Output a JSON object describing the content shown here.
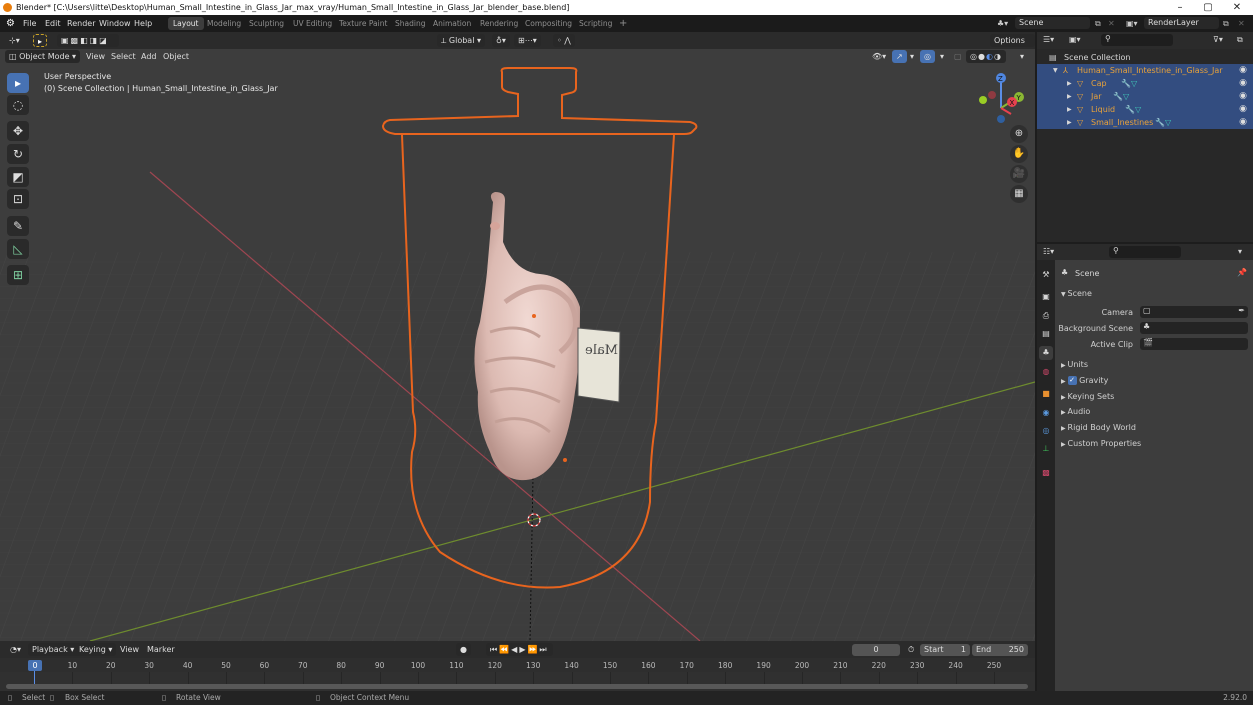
{
  "window": {
    "title": "Blender* [C:\\Users\\litte\\Desktop\\Human_Small_Intestine_in_Glass_Jar_max_vray/Human_Small_Intestine_in_Glass_Jar_blender_base.blend]",
    "controls": {
      "minimize": "–",
      "maximize": "▢",
      "close": "✕"
    }
  },
  "menubar": {
    "menus": [
      "File",
      "Edit",
      "Render",
      "Window",
      "Help"
    ],
    "workspaces": [
      "Layout",
      "Modeling",
      "Sculpting",
      "UV Editing",
      "Texture Paint",
      "Shading",
      "Animation",
      "Rendering",
      "Compositing",
      "Scripting"
    ],
    "active_workspace": "Layout",
    "add_workspace": "+",
    "scene_name": "Scene",
    "view_layer": "RenderLayer"
  },
  "viewport": {
    "transform_orientation": "Global",
    "mode": "Object Mode",
    "menus": [
      "View",
      "Select",
      "Add",
      "Object"
    ],
    "options_label": "Options",
    "overlay_title": "User Perspective",
    "overlay_subtitle": "(0) Scene Collection | Human_Small_Intestine_in_Glass_Jar",
    "gizmo_axes": {
      "x": "X",
      "y": "Y",
      "z": "Z"
    },
    "label_text": "Male",
    "colors": {
      "selection_outline": "#e8641e",
      "x_axis": "#c44a55",
      "y_axis": "#7fa532",
      "background": "#3d3d3d"
    }
  },
  "outliner": {
    "root": "Scene Collection",
    "collection": "Human_Small_Intestine_in_Glass_Jar",
    "objects": [
      {
        "name": "Cap"
      },
      {
        "name": "Jar"
      },
      {
        "name": "Liquid"
      },
      {
        "name": "Small_Inestines"
      }
    ]
  },
  "properties": {
    "context": "Scene",
    "panel": "Scene",
    "fields": [
      {
        "label": "Camera",
        "value": ""
      },
      {
        "label": "Background Scene",
        "value": ""
      },
      {
        "label": "Active Clip",
        "value": ""
      }
    ],
    "sections": [
      {
        "label": "Units",
        "checkbox": false
      },
      {
        "label": "Gravity",
        "checkbox": true,
        "checked": true
      },
      {
        "label": "Keying Sets",
        "checkbox": false
      },
      {
        "label": "Audio",
        "checkbox": false
      },
      {
        "label": "Rigid Body World",
        "checkbox": false
      },
      {
        "label": "Custom Properties",
        "checkbox": false
      }
    ]
  },
  "timeline": {
    "menus": [
      "Playback",
      "Keying",
      "View",
      "Marker"
    ],
    "current_frame": "0",
    "start_label": "Start",
    "start": "1",
    "end_label": "End",
    "end": "250",
    "ticks": [
      "0",
      "10",
      "20",
      "30",
      "40",
      "50",
      "60",
      "70",
      "80",
      "90",
      "100",
      "110",
      "120",
      "130",
      "140",
      "150",
      "160",
      "170",
      "180",
      "190",
      "200",
      "210",
      "220",
      "230",
      "240",
      "250"
    ]
  },
  "statusbar": {
    "select": "Select",
    "box_select": "Box Select",
    "rotate_view": "Rotate View",
    "context_menu": "Object Context Menu",
    "version": "2.92.0"
  }
}
